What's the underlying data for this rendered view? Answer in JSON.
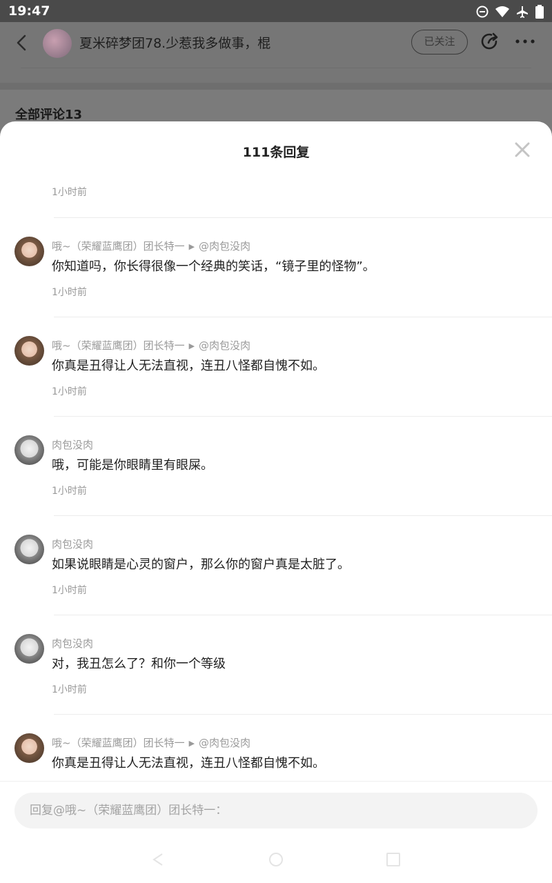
{
  "status_bar": {
    "time": "19:47",
    "icons": [
      "do-not-disturb-icon",
      "wifi-icon",
      "airplane-icon",
      "battery-icon"
    ]
  },
  "header": {
    "title": "夏米碎梦团78.少惹我多做事，棍",
    "follow_label": "已关注"
  },
  "section_title": "全部评论13",
  "sheet": {
    "title": "111条回复",
    "first_time": "1小时前",
    "replies": [
      {
        "author": "哦~（荣耀蓝鹰团）团长特一",
        "reply_to": "@肉包没肉",
        "content": "你知道吗，你长得很像一个经典的笑话，“镜子里的怪物”。",
        "time": "1小时前",
        "avatar": "girl"
      },
      {
        "author": "哦~（荣耀蓝鹰团）团长特一",
        "reply_to": "@肉包没肉",
        "content": "你真是丑得让人无法直视，连丑八怪都自愧不如。",
        "time": "1小时前",
        "avatar": "girl"
      },
      {
        "author": "肉包没肉",
        "reply_to": "",
        "content": "哦，可能是你眼睛里有眼屎。",
        "time": "1小时前",
        "avatar": "anime"
      },
      {
        "author": "肉包没肉",
        "reply_to": "",
        "content": "如果说眼睛是心灵的窗户，那么你的窗户真是太脏了。",
        "time": "1小时前",
        "avatar": "anime"
      },
      {
        "author": "肉包没肉",
        "reply_to": "",
        "content": "对，我丑怎么了？和你一个等级",
        "time": "1小时前",
        "avatar": "anime"
      },
      {
        "author": "哦~（荣耀蓝鹰团）团长特一",
        "reply_to": "@肉包没肉",
        "content": "你真是丑得让人无法直视，连丑八怪都自愧不如。",
        "time": "",
        "avatar": "girl"
      }
    ]
  },
  "input": {
    "placeholder": "回复@哦~（荣耀蓝鹰团）团长特一："
  }
}
